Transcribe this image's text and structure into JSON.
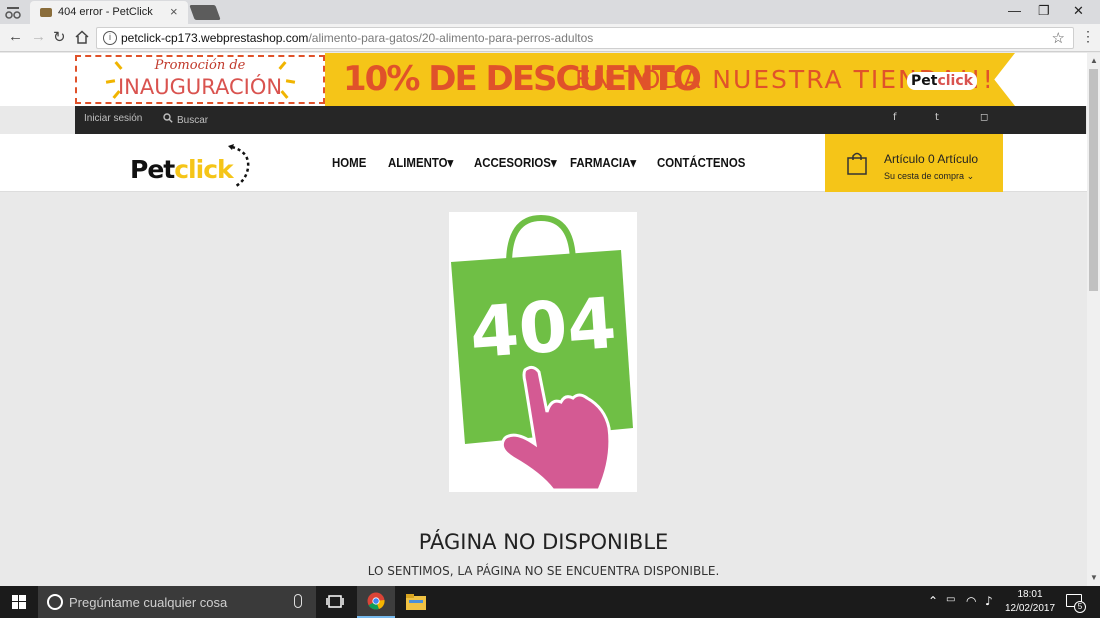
{
  "browser": {
    "tab_title": "404 error - PetClick",
    "url_host": "petclick-cp173.webprestashop.com",
    "url_path": "/alimento-para-gatos/20-alimento-para-perros-adultos"
  },
  "promo": {
    "left_line1": "Promoción de",
    "left_line2": "INAUGURACIÓN",
    "right_big": "10% DE DESCUENTO",
    "right_small": "EN TODA NUESTRA TIENDA!!!",
    "logo_pet": "Pet",
    "logo_click": "click",
    "colors": {
      "yellow": "#f5c518",
      "orange": "#e0522a"
    }
  },
  "topbar": {
    "login": "Iniciar sesión",
    "search_placeholder": "Buscar",
    "social": {
      "facebook": "f",
      "twitter": "t",
      "instagram": "◻"
    }
  },
  "header": {
    "brand_pet": "Pet",
    "brand_click": "click",
    "menu": [
      {
        "label": "HOME"
      },
      {
        "label": "ALIMENTO"
      },
      {
        "label": "ACCESORIOS"
      },
      {
        "label": "FARMACIA"
      },
      {
        "label": "CONTÁCTENOS"
      }
    ],
    "cart": {
      "line1": "Artículo 0 Artículo",
      "line2": "Su cesta de compra"
    }
  },
  "error": {
    "image_number": "404",
    "title": "PÁGINA NO DISPONIBLE",
    "subtitle": "LO SENTIMOS, LA PÁGINA NO SE ENCUENTRA DISPONIBLE."
  },
  "taskbar": {
    "search_placeholder": "Pregúntame cualquier cosa",
    "time": "18:01",
    "date": "12/02/2017",
    "notifications": "5"
  }
}
